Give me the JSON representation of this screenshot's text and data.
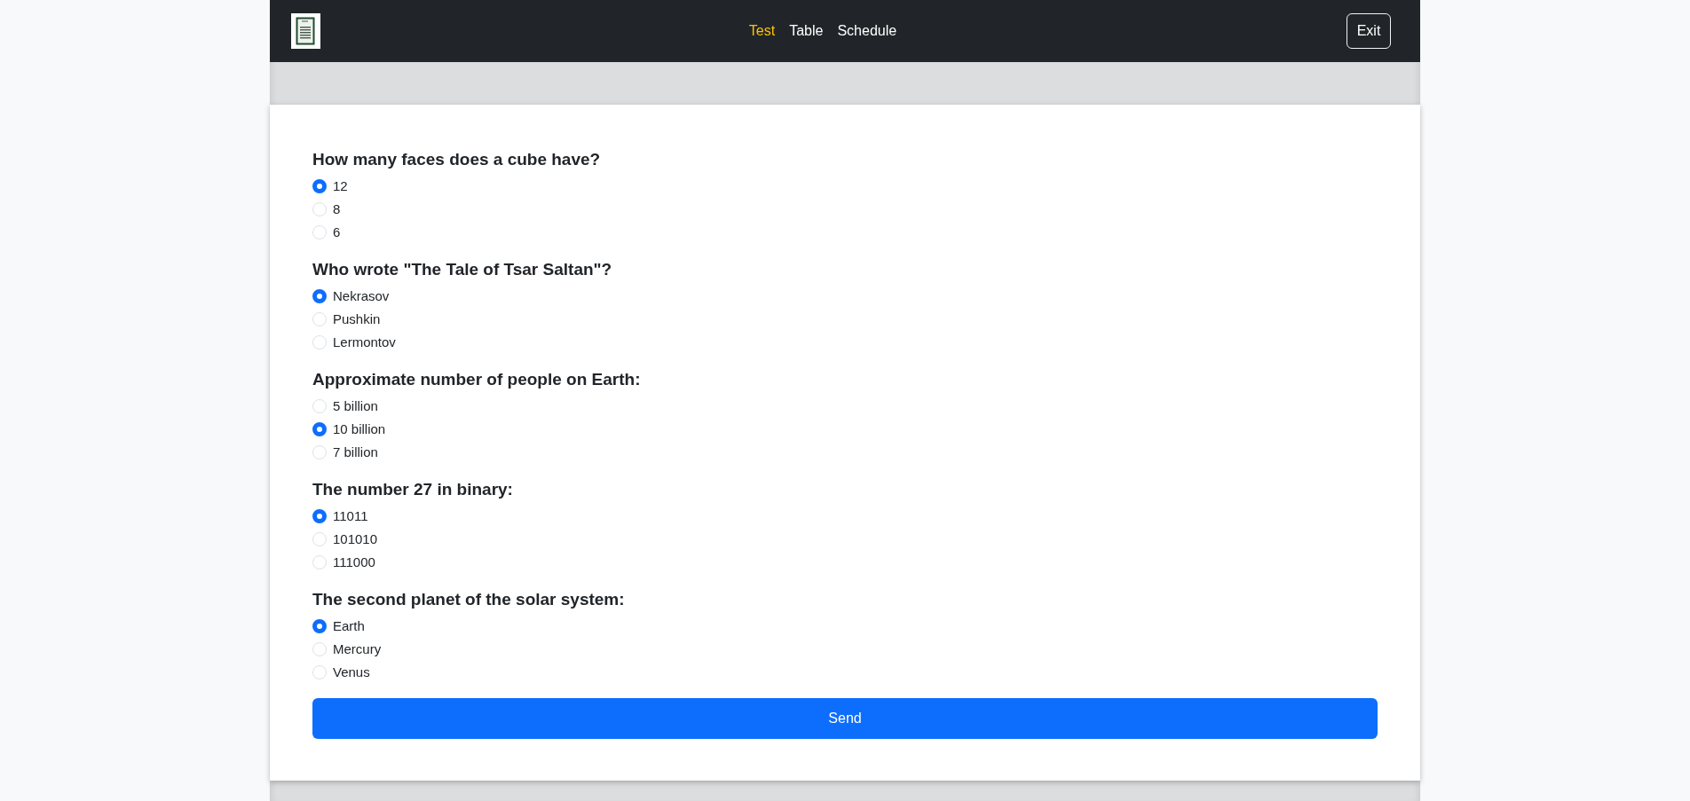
{
  "navbar": {
    "links": [
      {
        "label": "Test",
        "selected": true
      },
      {
        "label": "Table",
        "selected": false
      },
      {
        "label": "Schedule",
        "selected": false
      }
    ],
    "exit_button": "Exit"
  },
  "questions": [
    {
      "text": "How many faces does a cube have?",
      "options": [
        {
          "label": "12",
          "selected": true
        },
        {
          "label": "8",
          "selected": false
        },
        {
          "label": "6",
          "selected": false
        }
      ]
    },
    {
      "text": "Who wrote \"The Tale of Tsar Saltan\"?",
      "options": [
        {
          "label": "Nekrasov",
          "selected": true
        },
        {
          "label": "Pushkin",
          "selected": false
        },
        {
          "label": "Lermontov",
          "selected": false
        }
      ]
    },
    {
      "text": "Approximate number of people on Earth:",
      "options": [
        {
          "label": "5 billion",
          "selected": false
        },
        {
          "label": "10 billion",
          "selected": true
        },
        {
          "label": "7 billion",
          "selected": false
        }
      ]
    },
    {
      "text": "The number 27 in binary:",
      "options": [
        {
          "label": "11011",
          "selected": true
        },
        {
          "label": "101010",
          "selected": false
        },
        {
          "label": "111000",
          "selected": false
        }
      ]
    },
    {
      "text": "The second planet of the solar system:",
      "options": [
        {
          "label": "Earth",
          "selected": true
        },
        {
          "label": "Mercury",
          "selected": false
        },
        {
          "label": "Venus",
          "selected": false
        }
      ]
    }
  ],
  "submit_button": "Send"
}
